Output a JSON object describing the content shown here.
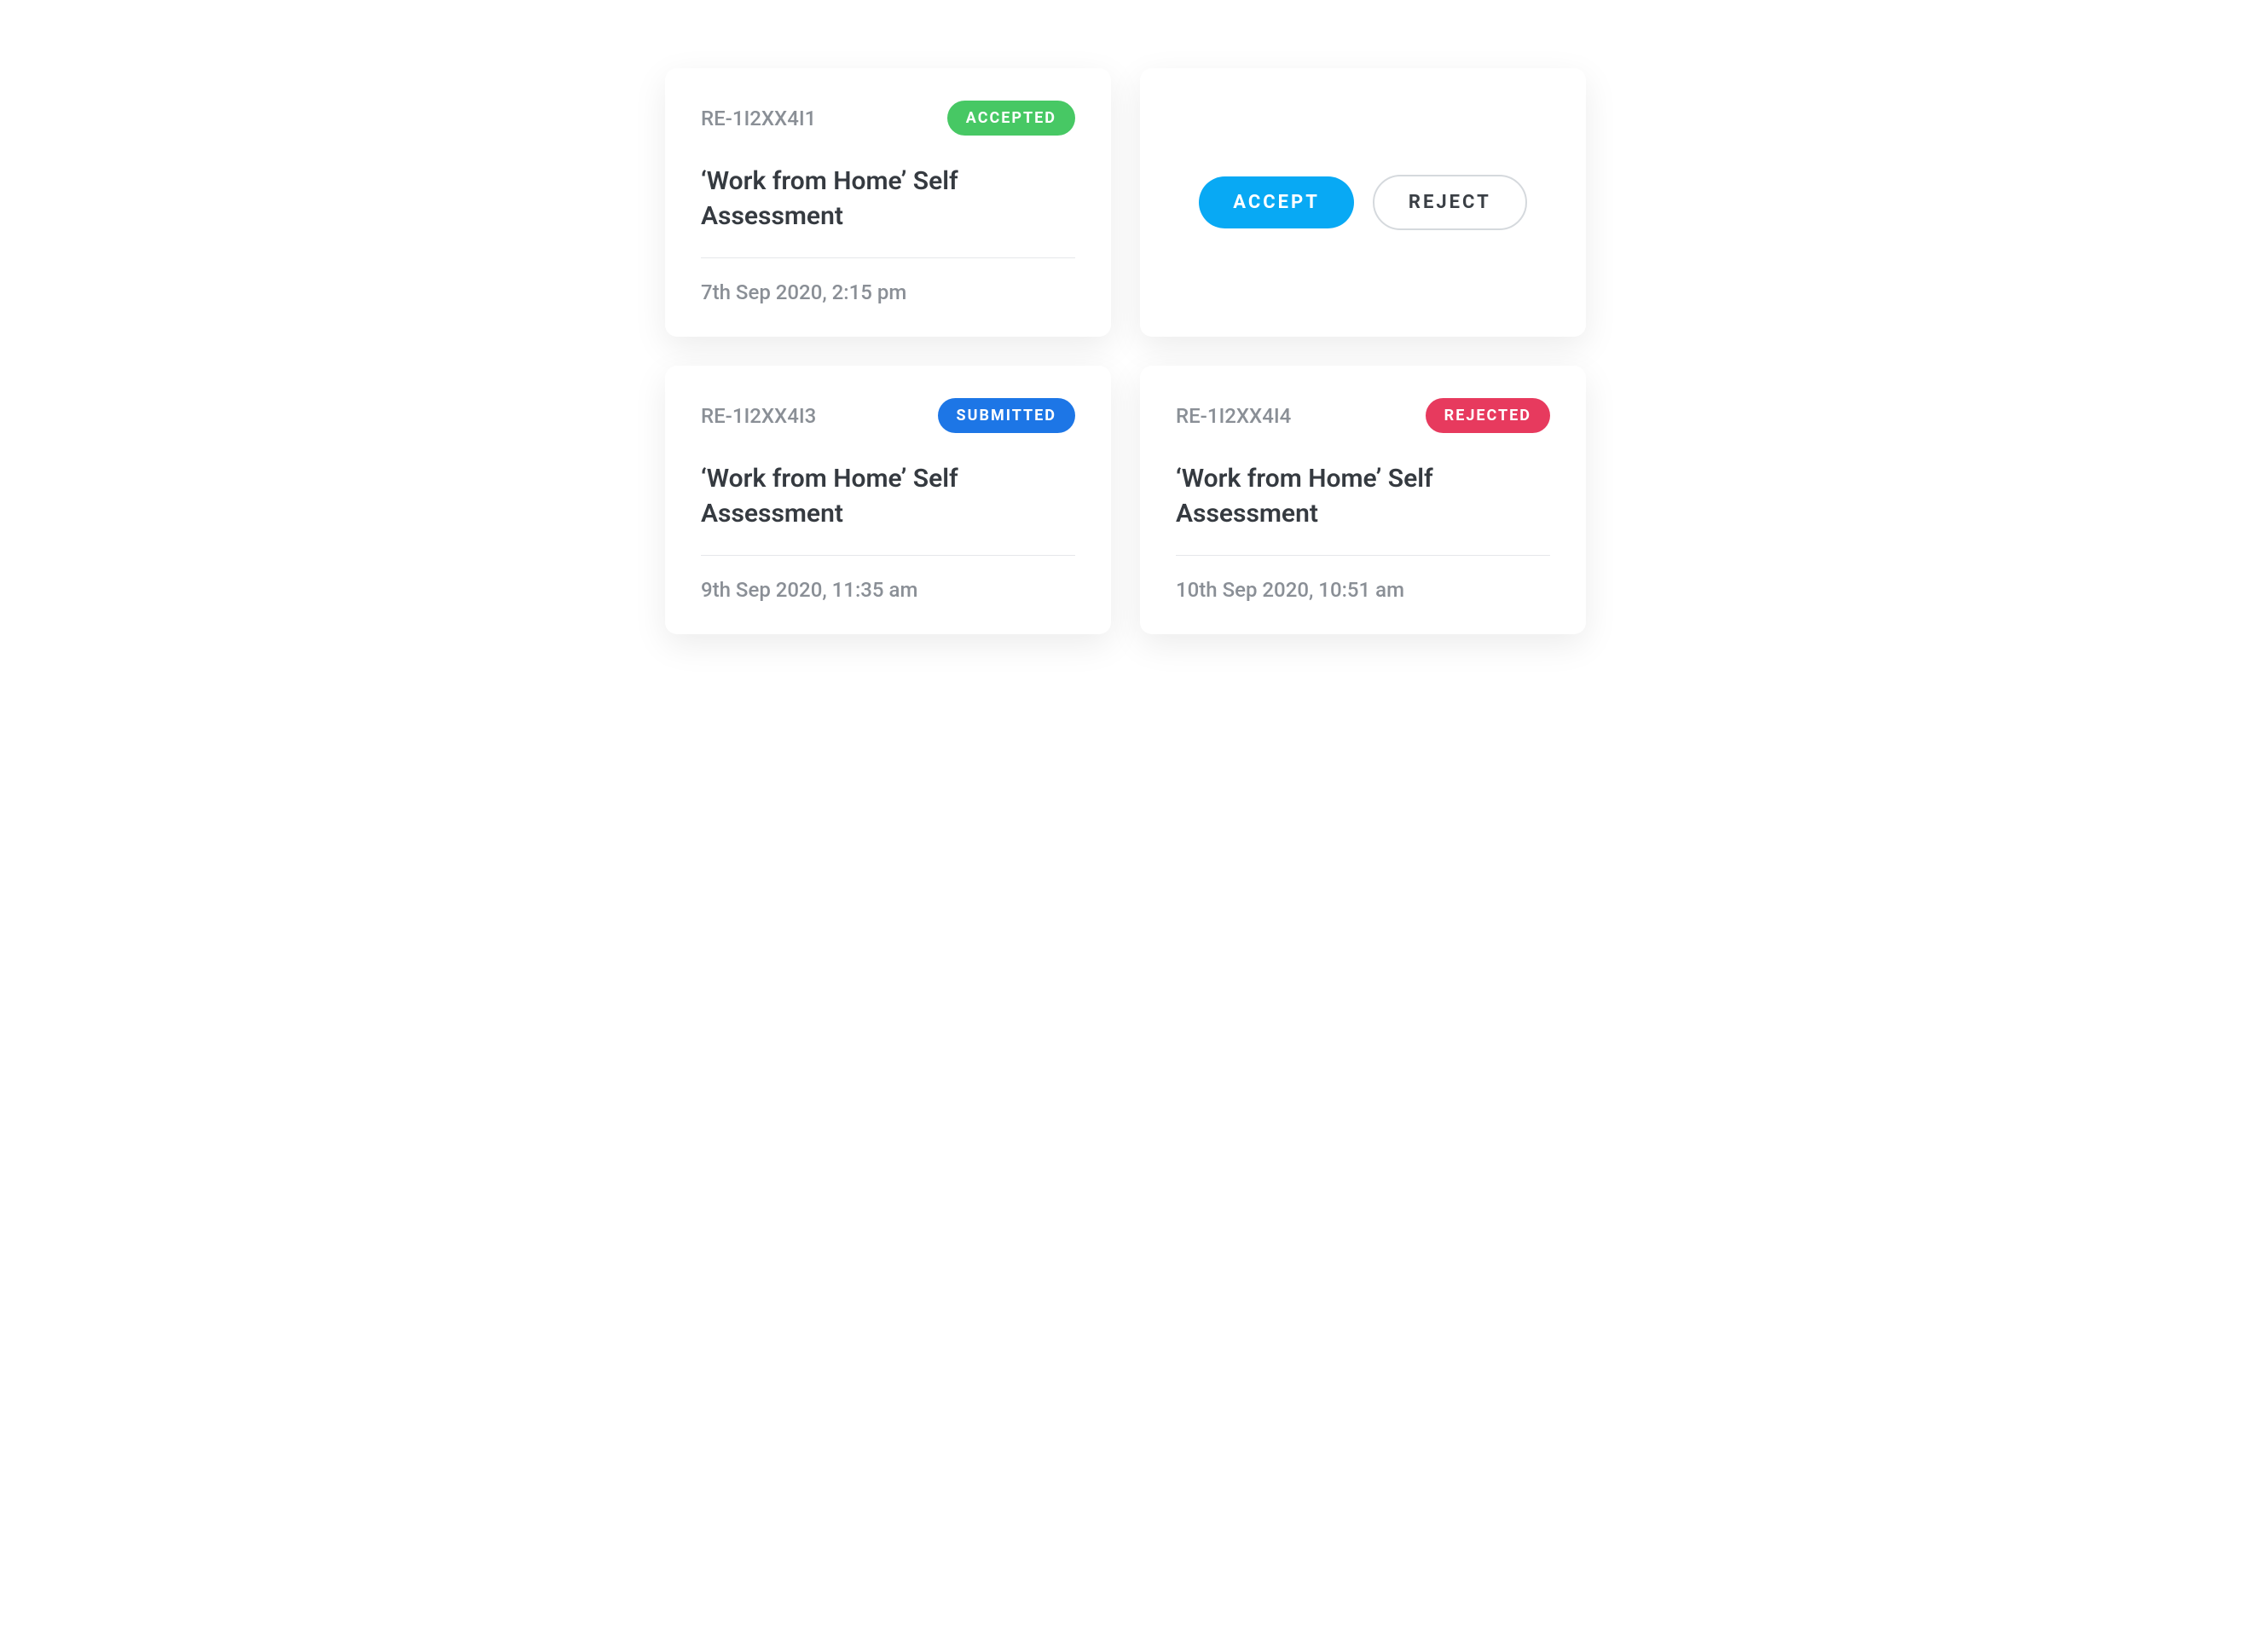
{
  "cards": [
    {
      "ref": "RE-1I2XX4I1",
      "status_label": "ACCEPTED",
      "status_class": "accepted",
      "title": "‘Work from Home’ Self Assessment",
      "timestamp": "7th Sep 2020, 2:15 pm"
    },
    {
      "ref": "RE-1I2XX4I3",
      "status_label": "SUBMITTED",
      "status_class": "submitted",
      "title": "‘Work from Home’ Self Assessment",
      "timestamp": "9th Sep 2020, 11:35 am"
    },
    {
      "ref": "RE-1I2XX4I4",
      "status_label": "REJECTED",
      "status_class": "rejected",
      "title": "‘Work from Home’ Self Assessment",
      "timestamp": "10th Sep 2020, 10:51 am"
    }
  ],
  "actions": {
    "accept_label": "ACCEPT",
    "reject_label": "REJECT"
  }
}
